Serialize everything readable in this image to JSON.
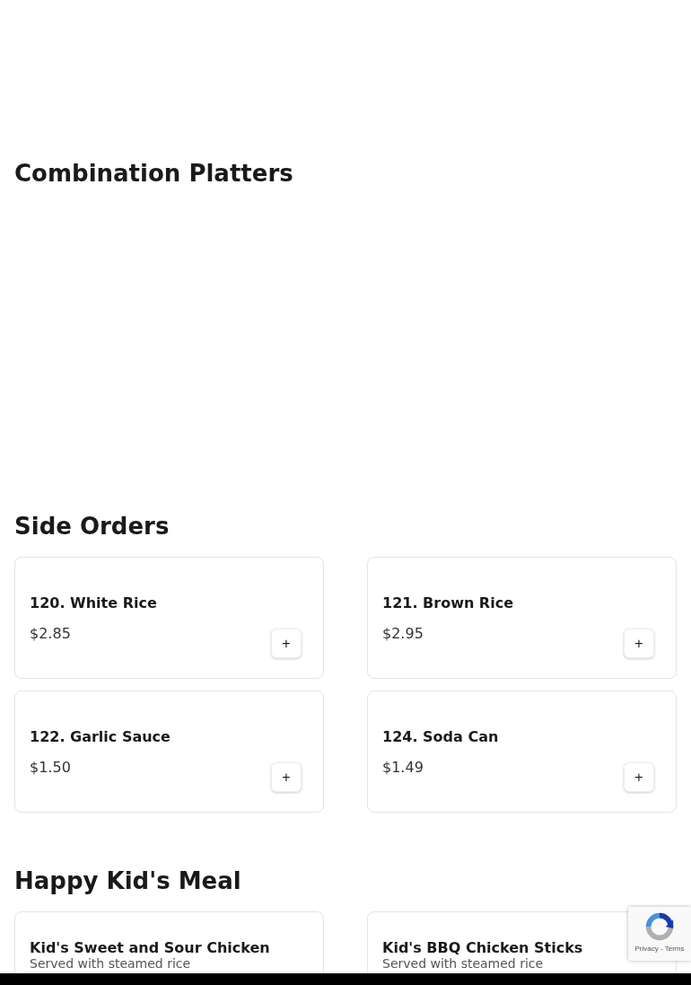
{
  "sections": [
    {
      "title": "Combination Platters"
    },
    {
      "title": "Side Orders",
      "items": [
        {
          "name": "120. White Rice",
          "price": "$2.85",
          "add": "+"
        },
        {
          "name": "121. Brown Rice",
          "price": "$2.95",
          "add": "+"
        },
        {
          "name": "122. Garlic Sauce",
          "price": "$1.50",
          "add": "+"
        },
        {
          "name": "124. Soda Can",
          "price": "$1.49",
          "add": "+"
        }
      ]
    },
    {
      "title": "Happy Kid's Meal",
      "items": [
        {
          "name": "Kid's Sweet and Sour Chicken",
          "description": "Served with steamed rice"
        },
        {
          "name": "Kid's BBQ Chicken Sticks",
          "description": "Served with steamed rice"
        }
      ]
    }
  ],
  "recaptcha": {
    "links": "Privacy - Terms"
  }
}
